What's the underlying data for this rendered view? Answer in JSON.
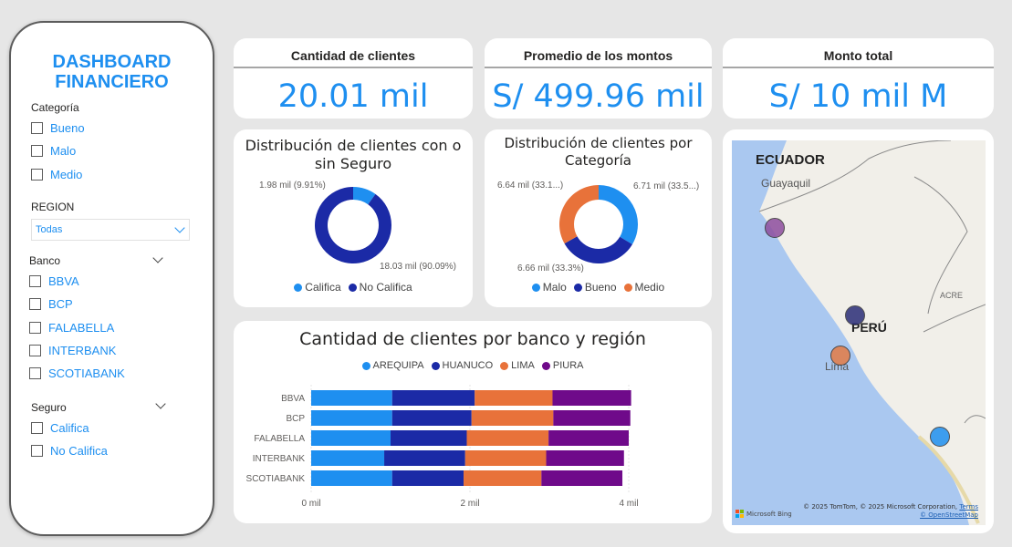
{
  "sidebar": {
    "title_line1": "DASHBOARD",
    "title_line2": "FINANCIERO",
    "categoria": {
      "title": "Categoría",
      "options": [
        "Bueno",
        "Malo",
        "Medio"
      ]
    },
    "region": {
      "title": "REGION",
      "selected": "Todas"
    },
    "banco": {
      "title": "Banco",
      "options": [
        "BBVA",
        "BCP",
        "FALABELLA",
        "INTERBANK",
        "SCOTIABANK"
      ]
    },
    "seguro": {
      "title": "Seguro",
      "options": [
        "Califica",
        "No Califica"
      ]
    }
  },
  "kpis": [
    {
      "title": "Cantidad de clientes",
      "value": "20.01 mil"
    },
    {
      "title": "Promedio de los montos",
      "value": "S/ 499.96 mil"
    },
    {
      "title": "Monto total",
      "value": "S/ 10 mil M"
    }
  ],
  "seguro_chart": {
    "title": "Distribución de clientes con o sin Seguro",
    "labels": [
      "1.98 mil (9.91%)",
      "18.03 mil (90.09%)"
    ],
    "legend": [
      "Califica",
      "No Califica"
    ]
  },
  "categoria_chart": {
    "title": "Distribución de clientes por Categoría",
    "labels": [
      "6.64 mil (33.1...)",
      "6.71 mil (33.5...)",
      "6.66 mil (33.3%)"
    ],
    "legend": [
      "Malo",
      "Bueno",
      "Medio"
    ]
  },
  "bar_chart": {
    "title": "Cantidad de clientes por banco y región",
    "legend": [
      "AREQUIPA",
      "HUANUCO",
      "LIMA",
      "PIURA"
    ],
    "x_ticks": [
      "0 mil",
      "2 mil",
      "4 mil"
    ]
  },
  "map": {
    "labels": {
      "ecuador": "ECUADOR",
      "guayaquil": "Guayaquil",
      "peru": "PERÚ",
      "lima": "Lima",
      "acre": "ACRE"
    },
    "attribution": "© 2025 TomTom, © 2025 Microsoft Corporation,",
    "terms": "Terms",
    "osm": "© OpenStreetMap",
    "bing": "Microsoft Bing",
    "bubble_colors": [
      "#8e4e9e",
      "#2b2e78",
      "#e37b45",
      "#1e8ff0"
    ]
  },
  "colors": {
    "accent": "#1e8ff0",
    "arequipa": "#1e8ff0",
    "huanuco": "#1b2aa6",
    "lima": "#e8723a",
    "piura": "#6f0a8a"
  },
  "chart_data": [
    {
      "type": "pie",
      "title": "Distribución de clientes con o sin Seguro",
      "categories": [
        "Califica",
        "No Califica"
      ],
      "values": [
        1980,
        18030
      ],
      "colors": [
        "#1e8ff0",
        "#1b2aa6"
      ]
    },
    {
      "type": "pie",
      "title": "Distribución de clientes por Categoría",
      "categories": [
        "Malo",
        "Bueno",
        "Medio"
      ],
      "values": [
        6710,
        6660,
        6640
      ],
      "colors": [
        "#1e8ff0",
        "#1b2aa6",
        "#e8723a"
      ]
    },
    {
      "type": "bar",
      "orientation": "horizontal",
      "stacked": true,
      "title": "Cantidad de clientes por banco y región",
      "categories": [
        "BBVA",
        "BCP",
        "FALABELLA",
        "INTERBANK",
        "SCOTIABANK"
      ],
      "series": [
        {
          "name": "AREQUIPA",
          "values": [
            1020,
            1020,
            1000,
            920,
            1020
          ]
        },
        {
          "name": "HUANUCO",
          "values": [
            1040,
            1000,
            960,
            1020,
            900
          ]
        },
        {
          "name": "LIMA",
          "values": [
            980,
            1030,
            1030,
            1020,
            980
          ]
        },
        {
          "name": "PIURA",
          "values": [
            990,
            970,
            1010,
            980,
            1020
          ]
        }
      ],
      "xlim": [
        0,
        4000
      ]
    }
  ]
}
